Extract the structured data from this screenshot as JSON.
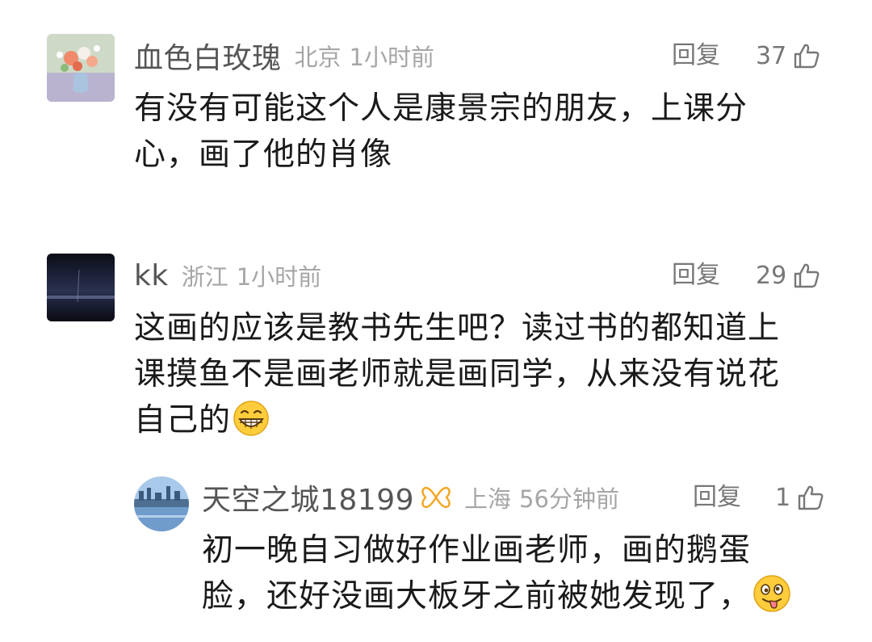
{
  "comments": [
    {
      "username": "血色白玫瑰",
      "location": "北京",
      "time": "1小时前",
      "reply_label": "回复",
      "likes": "37",
      "lines": [
        "有没有可能这个人是康景宗的朋友，上课分",
        "心，画了他的肖像"
      ],
      "avatar_icon": "flower-vase-avatar"
    },
    {
      "username": "kk",
      "location": "浙江",
      "time": "1小时前",
      "reply_label": "回复",
      "likes": "29",
      "lines": [
        "这画的应该是教书先生吧？读过书的都知道上",
        "课摸鱼不是画老师就是画同学，从来没有说花",
        "自己的"
      ],
      "avatar_icon": "dark-sky-avatar",
      "trailing_emoji": "grin-emoji"
    }
  ],
  "reply": {
    "username": "天空之城18199",
    "location": "上海",
    "time": "56分钟前",
    "reply_label": "回复",
    "likes": "1",
    "lines": [
      "初一晚自习做好作业画老师，画的鹅蛋",
      "脸，还好没画大板牙之前被她发现了，"
    ],
    "avatar_icon": "city-sky-avatar",
    "badge_icon": "butterfly-badge-icon",
    "trailing_emoji": "tongue-out-emoji"
  },
  "colors": {
    "username": "#555555",
    "meta": "#a6a6a6",
    "action": "#777777",
    "body_text": "#1a1a1a",
    "badge": "#f5a623"
  }
}
